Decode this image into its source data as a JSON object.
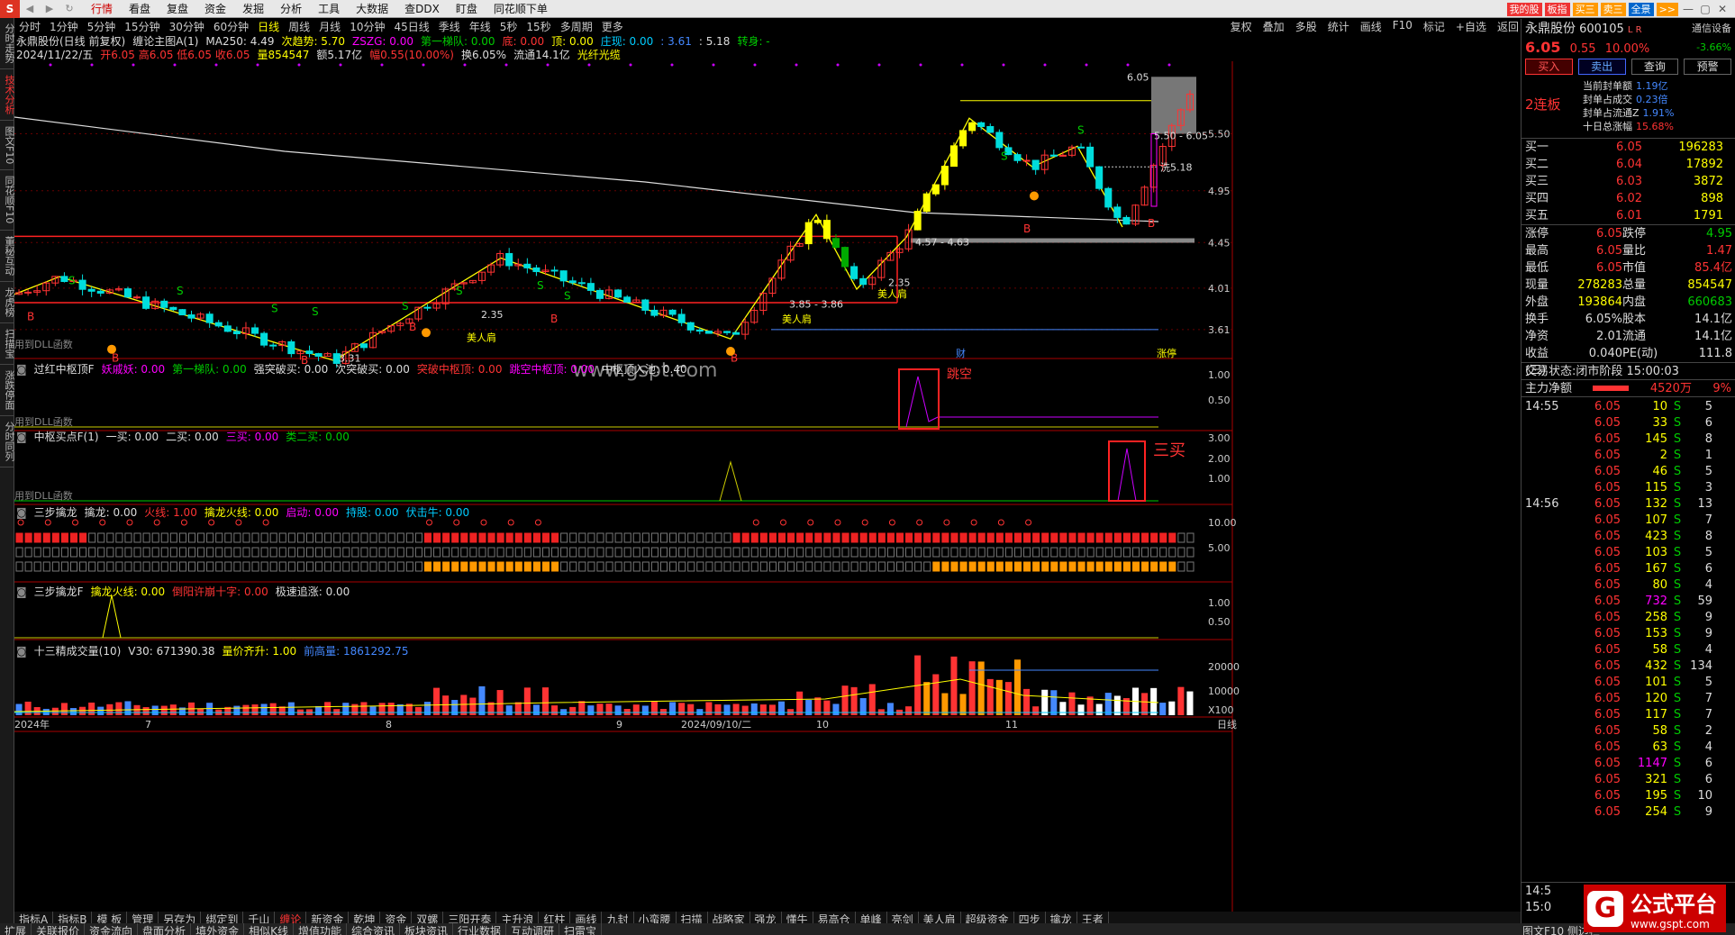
{
  "window": {
    "menu": [
      "行情",
      "看盘",
      "复盘",
      "资金",
      "发掘",
      "分析",
      "工具",
      "大数据",
      "查DDX",
      "盯盘",
      "同花顺下单"
    ],
    "active_menu": "行情",
    "right_tags": [
      "我的股",
      "板指",
      "买三",
      "卖三",
      "全景"
    ]
  },
  "sidetabs": [
    "分时走势",
    "技术分析",
    "图文F10",
    "同花顺F10",
    "董秘互动",
    "龙虎榜",
    "扫描宝",
    "涨跌停面",
    "分时同列"
  ],
  "periods": [
    "分时",
    "1分钟",
    "5分钟",
    "15分钟",
    "30分钟",
    "60分钟",
    "日线",
    "周线",
    "月线",
    "10分钟",
    "45日线",
    "季线",
    "年线",
    "5秒",
    "15秒",
    "多周期",
    "更多"
  ],
  "active_period": "日线",
  "right_tools": [
    "复权",
    "叠加",
    "多股",
    "统计",
    "画线",
    "F10",
    "标记",
    "+自选",
    "返回"
  ],
  "info": {
    "line1": [
      {
        "t": "永鼎股份(日线 前复权)",
        "c": "white"
      },
      {
        "t": "缠论主图A(1)",
        "c": "white"
      },
      {
        "t": "MA250: 4.49",
        "c": "white"
      },
      {
        "t": "次趋势: 5.70",
        "c": "yellow"
      },
      {
        "t": "ZSZG: 0.00",
        "c": "mag"
      },
      {
        "t": "第一梯队: 0.00",
        "c": "green"
      },
      {
        "t": "底: 0.00",
        "c": "red"
      },
      {
        "t": "顶: 0.00",
        "c": "yellow"
      },
      {
        "t": "庄现: 0.00",
        "c": "cyan"
      },
      {
        "t": ": 3.61",
        "c": "blue"
      },
      {
        "t": ": 5.18",
        "c": "white"
      },
      {
        "t": "转身: -",
        "c": "green"
      }
    ],
    "line2": [
      {
        "t": "2024/11/22/五",
        "c": "white"
      },
      {
        "t": "开6.05 高6.05 低6.05 收6.05",
        "c": "red"
      },
      {
        "t": "量854547",
        "c": "yellow"
      },
      {
        "t": "额5.17亿",
        "c": "white"
      },
      {
        "t": "幅0.55(10.00%)",
        "c": "red"
      },
      {
        "t": "换6.05%",
        "c": "white"
      },
      {
        "t": "流通14.1亿",
        "c": "white"
      },
      {
        "t": "光纤光缆",
        "c": "yellow"
      }
    ]
  },
  "main_chart": {
    "y_labels": [
      "5.50",
      "4.95",
      "4.45",
      "4.01",
      "3.61"
    ],
    "y_values": [
      5.5,
      4.95,
      4.45,
      4.01,
      3.61
    ],
    "ylim": [
      3.4,
      6.2
    ],
    "x_labels": [
      "2024年",
      "7",
      "8",
      "9",
      "2024/09/10/二",
      "10",
      "11",
      "日线"
    ],
    "annotations": {
      "high": "6.05",
      "range_box": "5.50 - 6.05",
      "wash": "洗5.18",
      "mid_zone": "4.57 - 4.63",
      "low_zone": "3.85 - 3.86",
      "low_331": "3.31",
      "l235a": "2.35",
      "l235b": "2.35",
      "beauty1": "美人肩",
      "beauty2": "美人肩",
      "beauty3": "美人肩",
      "cai": "财",
      "zhangting": "涨停",
      "dll": "用到DLL函数"
    },
    "watermark": "www.gspt.com"
  },
  "pane1": {
    "title": "过红中枢顶F",
    "values": [
      {
        "t": "妖戚妖: 0.00",
        "c": "mag"
      },
      {
        "t": "第一梯队: 0.00",
        "c": "green"
      },
      {
        "t": "强突破买: 0.00",
        "c": "white"
      },
      {
        "t": "次突破买: 0.00",
        "c": "white"
      },
      {
        "t": "突破中枢顶: 0.00",
        "c": "red"
      },
      {
        "t": "跳空中枢顶: 0.00",
        "c": "mag"
      },
      {
        "t": "中枢顶入池: 0.40",
        "c": "white"
      }
    ],
    "y_labels": [
      "1.00",
      "0.50"
    ],
    "callout": "跳空",
    "dll": "用到DLL函数"
  },
  "pane2": {
    "title": "中枢买点F(1)",
    "values": [
      {
        "t": "一买: 0.00",
        "c": "white"
      },
      {
        "t": "二买: 0.00",
        "c": "white"
      },
      {
        "t": "三买: 0.00",
        "c": "mag"
      },
      {
        "t": "类二买: 0.00",
        "c": "green"
      }
    ],
    "y_labels": [
      "3.00",
      "2.00",
      "1.00"
    ],
    "callout": "三买",
    "dll": "用到DLL函数"
  },
  "pane3": {
    "title": "三步擒龙",
    "values": [
      {
        "t": "擒龙: 0.00",
        "c": "white"
      },
      {
        "t": "火线: 1.00",
        "c": "red"
      },
      {
        "t": "擒龙火线: 0.00",
        "c": "yellow"
      },
      {
        "t": "启动: 0.00",
        "c": "mag"
      },
      {
        "t": "持股: 0.00",
        "c": "cyan"
      },
      {
        "t": "伏击牛: 0.00",
        "c": "cyan"
      }
    ],
    "y_labels": [
      "10.00",
      "5.00"
    ]
  },
  "pane4": {
    "title": "三步擒龙F",
    "values": [
      {
        "t": "擒龙火线: 0.00",
        "c": "yellow"
      },
      {
        "t": "倒阳许崩十字: 0.00",
        "c": "red"
      },
      {
        "t": "极速追涨: 0.00",
        "c": "white"
      }
    ],
    "y_labels": [
      "1.00",
      "0.50"
    ]
  },
  "pane5": {
    "title": "十三精成交量(10)",
    "values": [
      {
        "t": "V30: 671390.38",
        "c": "white"
      },
      {
        "t": "量价齐升: 1.00",
        "c": "yellow"
      },
      {
        "t": "前高量: 1861292.75",
        "c": "blue"
      }
    ],
    "y_labels": [
      "20000",
      "10000",
      "X100"
    ]
  },
  "stock": {
    "name": "永鼎股份",
    "code": "600105",
    "flags": "L R",
    "setting": "通信设备",
    "price": "6.05",
    "change": "0.55",
    "pct": "10.00%",
    "side_pct": "-3.66%",
    "buttons": [
      "买入",
      "卖出",
      "查询",
      "预警"
    ],
    "streak": "2连板",
    "seal": [
      {
        "k": "当前封单额",
        "v": "1.19亿"
      },
      {
        "k": "封单占成交",
        "v": "0.23倍"
      },
      {
        "k": "封单占流通Z",
        "v": "1.91%"
      },
      {
        "k": "十日总涨幅",
        "v": "15.68%"
      }
    ],
    "orderbook": [
      {
        "l": "买一",
        "p": "6.05",
        "v": "196283"
      },
      {
        "l": "买二",
        "p": "6.04",
        "v": "17892"
      },
      {
        "l": "买三",
        "p": "6.03",
        "v": "3872"
      },
      {
        "l": "买四",
        "p": "6.02",
        "v": "898"
      },
      {
        "l": "买五",
        "p": "6.01",
        "v": "1791"
      }
    ],
    "stats": [
      [
        "涨停",
        "6.05",
        "跌停",
        "4.95"
      ],
      [
        "最高",
        "6.05",
        "量比",
        "1.47"
      ],
      [
        "最低",
        "6.05",
        "市值",
        "85.4亿"
      ],
      [
        "现量",
        "278283",
        "总量",
        "854547"
      ],
      [
        "外盘",
        "193864",
        "内盘",
        "660683"
      ],
      [
        "换手",
        "6.05%",
        "股本",
        "14.1亿"
      ],
      [
        "净资",
        "2.01",
        "流通",
        "14.1亿"
      ],
      [
        "收益(三)",
        "0.040",
        "PE(动)",
        "111.8"
      ]
    ],
    "trade_state_label": "交易状态:",
    "trade_state": "闭市阶段 15:00:03",
    "main_flow_label": "主力净额",
    "main_flow": "4520万",
    "main_flow_pct": "9%",
    "ticks": [
      {
        "t": "14:55",
        "p": "6.05",
        "v": "10",
        "s": "S",
        "n": "5"
      },
      {
        "t": "",
        "p": "6.05",
        "v": "33",
        "s": "S",
        "n": "6"
      },
      {
        "t": "",
        "p": "6.05",
        "v": "145",
        "s": "S",
        "n": "8"
      },
      {
        "t": "",
        "p": "6.05",
        "v": "2",
        "s": "S",
        "n": "1"
      },
      {
        "t": "",
        "p": "6.05",
        "v": "46",
        "s": "S",
        "n": "5"
      },
      {
        "t": "",
        "p": "6.05",
        "v": "115",
        "s": "S",
        "n": "3"
      },
      {
        "t": "14:56",
        "p": "6.05",
        "v": "132",
        "s": "S",
        "n": "13"
      },
      {
        "t": "",
        "p": "6.05",
        "v": "107",
        "s": "S",
        "n": "7"
      },
      {
        "t": "",
        "p": "6.05",
        "v": "423",
        "s": "S",
        "n": "8"
      },
      {
        "t": "",
        "p": "6.05",
        "v": "103",
        "s": "S",
        "n": "5"
      },
      {
        "t": "",
        "p": "6.05",
        "v": "167",
        "s": "S",
        "n": "6"
      },
      {
        "t": "",
        "p": "6.05",
        "v": "80",
        "s": "S",
        "n": "4"
      },
      {
        "t": "",
        "p": "6.05",
        "v": "732",
        "s": "S",
        "n": "59"
      },
      {
        "t": "",
        "p": "6.05",
        "v": "258",
        "s": "S",
        "n": "9"
      },
      {
        "t": "",
        "p": "6.05",
        "v": "153",
        "s": "S",
        "n": "9"
      },
      {
        "t": "",
        "p": "6.05",
        "v": "58",
        "s": "S",
        "n": "4"
      },
      {
        "t": "",
        "p": "6.05",
        "v": "432",
        "s": "S",
        "n": "134"
      },
      {
        "t": "",
        "p": "6.05",
        "v": "101",
        "s": "S",
        "n": "5"
      },
      {
        "t": "",
        "p": "6.05",
        "v": "120",
        "s": "S",
        "n": "7"
      },
      {
        "t": "",
        "p": "6.05",
        "v": "117",
        "s": "S",
        "n": "7"
      },
      {
        "t": "",
        "p": "6.05",
        "v": "58",
        "s": "S",
        "n": "2"
      },
      {
        "t": "",
        "p": "6.05",
        "v": "63",
        "s": "S",
        "n": "4"
      },
      {
        "t": "",
        "p": "6.05",
        "v": "1147",
        "s": "S",
        "n": "6"
      },
      {
        "t": "",
        "p": "6.05",
        "v": "321",
        "s": "S",
        "n": "6"
      },
      {
        "t": "",
        "p": "6.05",
        "v": "195",
        "s": "S",
        "n": "10"
      },
      {
        "t": "",
        "p": "6.05",
        "v": "254",
        "s": "S",
        "n": "9"
      }
    ],
    "bottom_time": "14:5",
    "bottom_time2": "15:0"
  },
  "bottom_tabs1": [
    "指标A",
    "指标B",
    "模 板",
    "管理",
    "另存为",
    "绑定到",
    "千山",
    "缠论",
    "新资金",
    "乾坤",
    "资金",
    "双螺",
    "三阳开泰",
    "主升浪",
    "红柱",
    "画线",
    "九封",
    "小蛮腰",
    "扫描",
    "战略家",
    "强龙",
    "懂牛",
    "易高仓",
    "单峰",
    "亮剑",
    "美人肩",
    "超级资金",
    "四步",
    "擒龙",
    "王者"
  ],
  "bottom_active1": "缠论",
  "bottom_tabs2": [
    "扩展",
    "关联报价",
    "资金流向",
    "盘面分析",
    "填外资金",
    "相似K线",
    "增值功能",
    "综合资讯",
    "板块资讯",
    "行业数据",
    "互动调研",
    "扫雷宝"
  ],
  "bottom_right2": "图文F10 侧边栏",
  "logo": {
    "text": "公式平台",
    "url": "www.gspt.com"
  },
  "colors": {
    "up": "#ff3333",
    "down": "#00dddd",
    "bg": "#000000",
    "grid": "#b00000"
  }
}
